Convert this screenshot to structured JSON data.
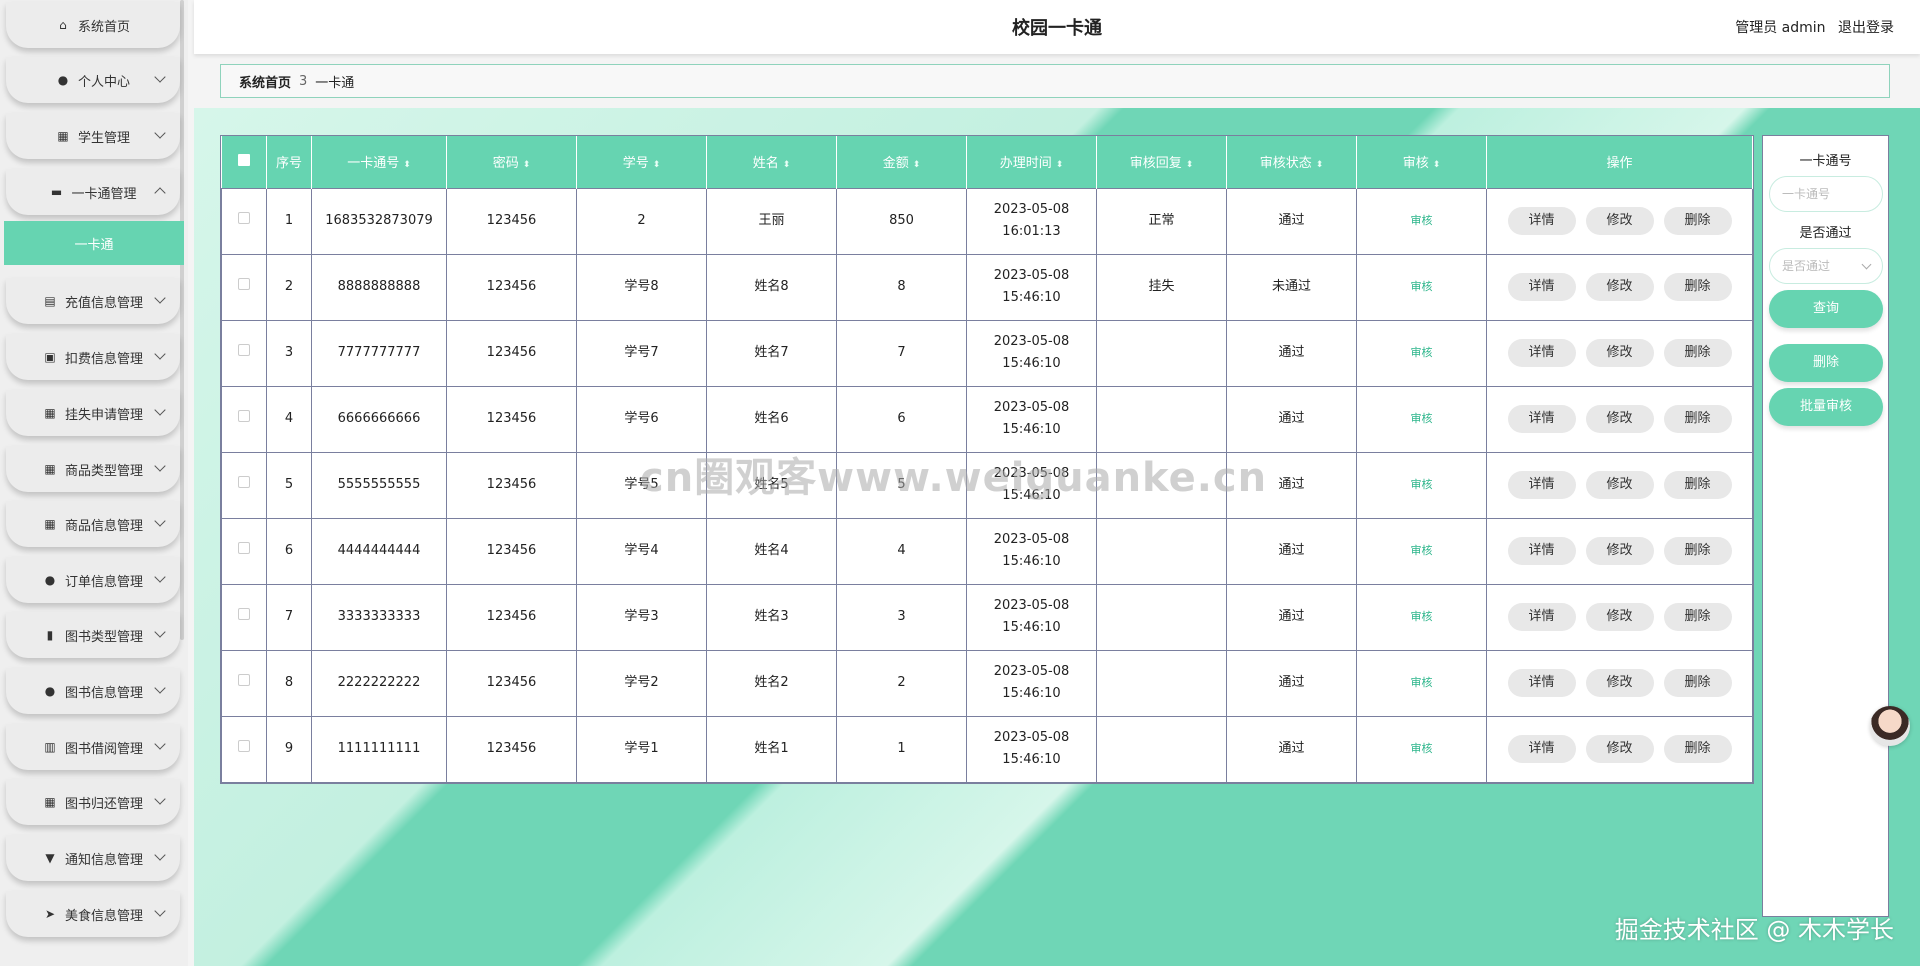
{
  "sidebar": {
    "items": [
      {
        "label": "系统首页",
        "icon": "home-icon"
      },
      {
        "label": "个人中心",
        "icon": "user-icon"
      },
      {
        "label": "学生管理",
        "icon": "grid-icon"
      },
      {
        "label": "一卡通管理",
        "icon": "monitor-icon",
        "expanded": true
      },
      {
        "label": "充值信息管理",
        "icon": "clipboard-icon"
      },
      {
        "label": "扣费信息管理",
        "icon": "clipboard-check-icon"
      },
      {
        "label": "挂失申请管理",
        "icon": "grid-icon"
      },
      {
        "label": "商品类型管理",
        "icon": "grid-icon"
      },
      {
        "label": "商品信息管理",
        "icon": "grid-icon"
      },
      {
        "label": "订单信息管理",
        "icon": "user-icon"
      },
      {
        "label": "图书类型管理",
        "icon": "bar-chart-icon"
      },
      {
        "label": "图书信息管理",
        "icon": "pin-icon"
      },
      {
        "label": "图书借阅管理",
        "icon": "book-icon"
      },
      {
        "label": "图书归还管理",
        "icon": "grid-icon"
      },
      {
        "label": "通知信息管理",
        "icon": "trophy-icon"
      },
      {
        "label": "美食信息管理",
        "icon": "send-icon"
      }
    ],
    "submenu_item": "一卡通"
  },
  "header": {
    "title": "校园一卡通",
    "role": "管理员 admin",
    "logout": "退出登录"
  },
  "breadcrumb": {
    "home": "系统首页",
    "separator": "3",
    "current": "一卡通"
  },
  "table": {
    "headers": [
      "序号",
      "一卡通号",
      "密码",
      "学号",
      "姓名",
      "金额",
      "办理时间",
      "审核回复",
      "审核状态",
      "审核",
      "操作"
    ],
    "rows": [
      {
        "idx": "1",
        "card": "1683532873079",
        "pwd": "123456",
        "sid": "2",
        "name": "王丽",
        "amount": "850",
        "time": "2023-05-08 16:01:13",
        "reply": "正常",
        "status": "通过"
      },
      {
        "idx": "2",
        "card": "8888888888",
        "pwd": "123456",
        "sid": "学号8",
        "name": "姓名8",
        "amount": "8",
        "time": "2023-05-08 15:46:10",
        "reply": "挂失",
        "status": "未通过"
      },
      {
        "idx": "3",
        "card": "7777777777",
        "pwd": "123456",
        "sid": "学号7",
        "name": "姓名7",
        "amount": "7",
        "time": "2023-05-08 15:46:10",
        "reply": "",
        "status": "通过"
      },
      {
        "idx": "4",
        "card": "6666666666",
        "pwd": "123456",
        "sid": "学号6",
        "name": "姓名6",
        "amount": "6",
        "time": "2023-05-08 15:46:10",
        "reply": "",
        "status": "通过"
      },
      {
        "idx": "5",
        "card": "5555555555",
        "pwd": "123456",
        "sid": "学号5",
        "name": "姓名5",
        "amount": "5",
        "time": "2023-05-08 15:46:10",
        "reply": "",
        "status": "通过"
      },
      {
        "idx": "6",
        "card": "4444444444",
        "pwd": "123456",
        "sid": "学号4",
        "name": "姓名4",
        "amount": "4",
        "time": "2023-05-08 15:46:10",
        "reply": "",
        "status": "通过"
      },
      {
        "idx": "7",
        "card": "3333333333",
        "pwd": "123456",
        "sid": "学号3",
        "name": "姓名3",
        "amount": "3",
        "time": "2023-05-08 15:46:10",
        "reply": "",
        "status": "通过"
      },
      {
        "idx": "8",
        "card": "2222222222",
        "pwd": "123456",
        "sid": "学号2",
        "name": "姓名2",
        "amount": "2",
        "time": "2023-05-08 15:46:10",
        "reply": "",
        "status": "通过"
      },
      {
        "idx": "9",
        "card": "1111111111",
        "pwd": "123456",
        "sid": "学号1",
        "name": "姓名1",
        "amount": "1",
        "time": "2023-05-08 15:46:10",
        "reply": "",
        "status": "通过"
      }
    ],
    "audit_label": "审核",
    "op_labels": {
      "detail": "详情",
      "edit": "修改",
      "delete": "删除"
    }
  },
  "search_panel": {
    "card_label": "一卡通号",
    "card_placeholder": "一卡通号",
    "pass_label": "是否通过",
    "pass_placeholder": "是否通过",
    "query_btn": "查询",
    "delete_btn": "删除",
    "batch_btn": "批量审核"
  },
  "watermark": "cn圈观客www.weiguanke.cn",
  "footer_watermark": "掘金技术社区 @ 木木学长",
  "colors": {
    "accent": "#66d4b1",
    "audit_link": "#2bb58a"
  }
}
